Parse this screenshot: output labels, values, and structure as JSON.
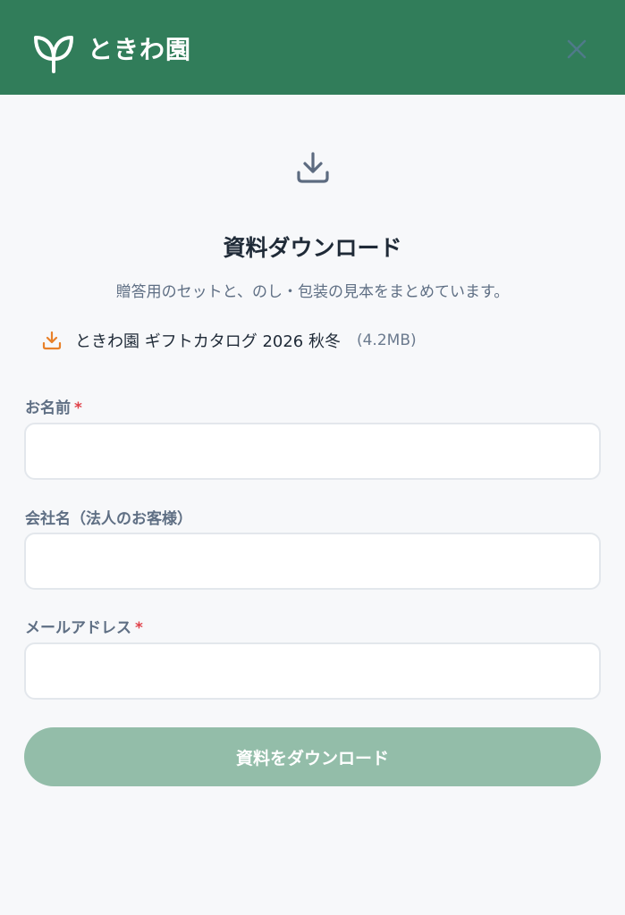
{
  "header": {
    "brand": "ときわ園",
    "logo_icon": "leaf-icon",
    "close_icon": "close-icon",
    "background_color": "#317d5a"
  },
  "main": {
    "hero_icon": "download-icon",
    "title": "資料ダウンロード",
    "subtitle": "贈答用のセットと、のし・包装の見本をまとめています。",
    "file": {
      "icon": "download-icon",
      "icon_color": "#e8812a",
      "name": "ときわ園 ギフトカタログ 2026 秋冬",
      "size": "(4.2MB)"
    }
  },
  "form": {
    "name": {
      "label": "お名前",
      "required_mark": "*",
      "value": ""
    },
    "company": {
      "label": "会社名（法人のお客様）",
      "value": ""
    },
    "email": {
      "label": "メールアドレス",
      "required_mark": "*",
      "value": ""
    },
    "submit_label": "資料をダウンロード",
    "submit_color": "#93bda9",
    "required_color": "#e0424a"
  }
}
